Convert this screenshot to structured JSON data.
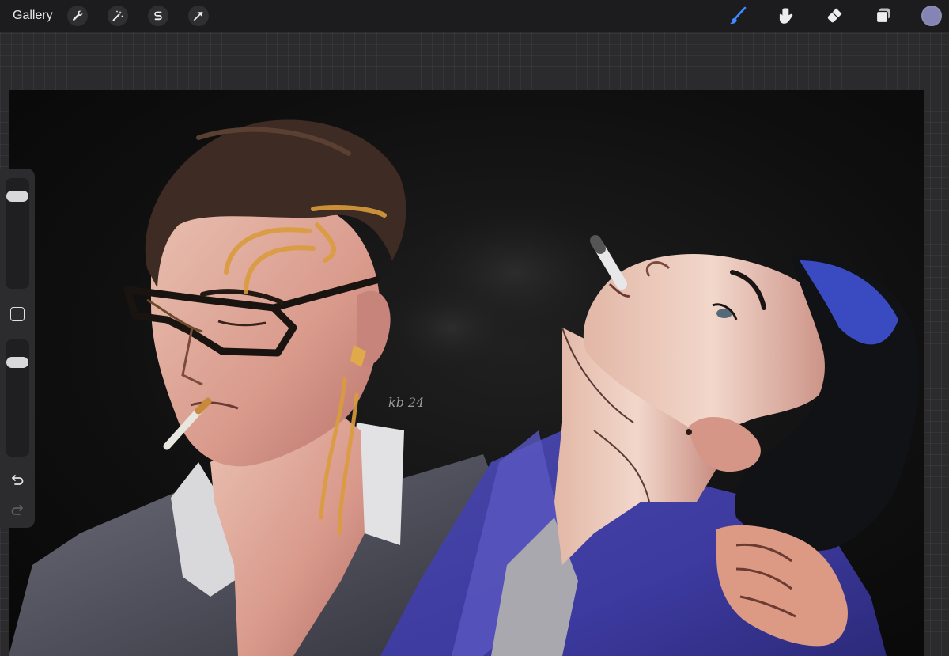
{
  "toolbar": {
    "gallery_label": "Gallery",
    "left_tools": [
      {
        "name": "actions",
        "icon": "wrench-icon"
      },
      {
        "name": "adjustments",
        "icon": "magic-wand-icon"
      },
      {
        "name": "selection",
        "icon": "selection-s-icon"
      },
      {
        "name": "transform",
        "icon": "arrow-cursor-icon"
      }
    ],
    "right_tools": [
      {
        "name": "brush",
        "icon": "brush-icon",
        "active": true
      },
      {
        "name": "smudge",
        "icon": "smudge-finger-icon"
      },
      {
        "name": "eraser",
        "icon": "eraser-icon"
      },
      {
        "name": "layers",
        "icon": "layers-icon"
      }
    ],
    "current_color": "#8585b5",
    "active_color": "#3d8bff"
  },
  "sidebar": {
    "brush_size_level": 0.05,
    "opacity_level": 0.05,
    "modify_icon": "square-icon",
    "undo_icon": "undo-arrow-icon",
    "redo_icon": "redo-arrow-icon"
  },
  "canvas": {
    "content": "digital-painting",
    "signature_text": "kb 24"
  }
}
